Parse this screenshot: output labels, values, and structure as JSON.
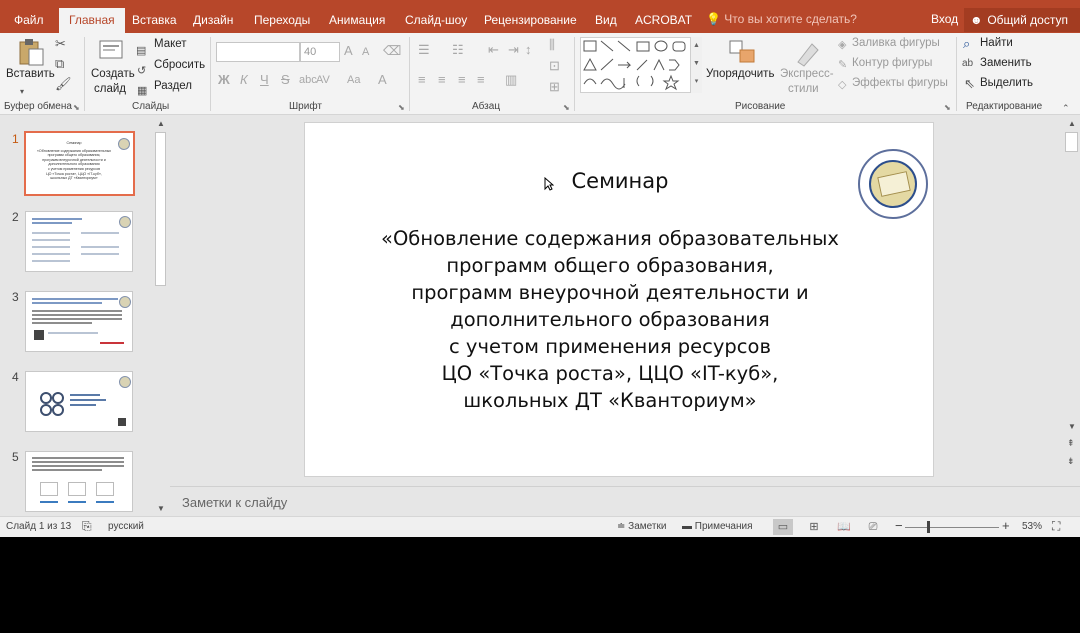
{
  "tabs": [
    "Файл",
    "Главная",
    "Вставка",
    "Дизайн",
    "Переходы",
    "Анимация",
    "Слайд-шоу",
    "Рецензирование",
    "Вид",
    "ACROBAT"
  ],
  "active_tab": "Главная",
  "tell_me": "Что вы хотите сделать?",
  "login": "Вход",
  "share": "Общий доступ",
  "ribbon": {
    "clipboard": {
      "paste": "Вставить",
      "label": "Буфер обмена"
    },
    "slides": {
      "new_slide": "Создать",
      "new_slide2": "слайд",
      "layout": "Макет",
      "reset": "Сбросить",
      "section": "Раздел",
      "label": "Слайды"
    },
    "font": {
      "size": "40",
      "label": "Шрифт",
      "bold": "Ж",
      "italic": "К",
      "underline": "Ч",
      "strike": "S",
      "spacing": "AV",
      "case": "Aa"
    },
    "paragraph": {
      "label": "Абзац"
    },
    "drawing": {
      "arrange": "Упорядочить",
      "styles": "Экспресс-",
      "styles2": "стили",
      "fill": "Заливка фигуры",
      "outline": "Контур фигуры",
      "effects": "Эффекты фигуры",
      "label": "Рисование"
    },
    "editing": {
      "find": "Найти",
      "replace": "Заменить",
      "select": "Выделить",
      "label": "Редактирование"
    }
  },
  "thumbnails": [
    {
      "num": "1"
    },
    {
      "num": "2"
    },
    {
      "num": "3"
    },
    {
      "num": "4"
    },
    {
      "num": "5"
    }
  ],
  "thumb1_text": [
    "Семинар",
    "«Обновление содержания образовательных",
    "программ общего образования,",
    "программ внеурочной деятельности и",
    "дополнительного образования",
    "с учетом применения ресурсов",
    "ЦО «Точка роста», ЦЦО «IT-куб»,",
    "школьных ДТ «Кванториум»"
  ],
  "slide": {
    "title": "Семинар",
    "lines": [
      "«Обновление содержания образовательных",
      "программ общего образования,",
      "программ внеурочной деятельности и",
      "дополнительного образования",
      "с учетом применения ресурсов",
      "ЦО «Точка роста», ЦЦО «IT-куб»,",
      "школьных ДТ «Кванториум»"
    ]
  },
  "notes_placeholder": "Заметки к слайду",
  "status": {
    "slide_counter": "Слайд 1 из 13",
    "language": "русский",
    "notes": "Заметки",
    "comments": "Примечания",
    "zoom": "53%"
  },
  "colors": {
    "accent": "#b7472a",
    "selected_thumb_border": "#e46c4b"
  }
}
